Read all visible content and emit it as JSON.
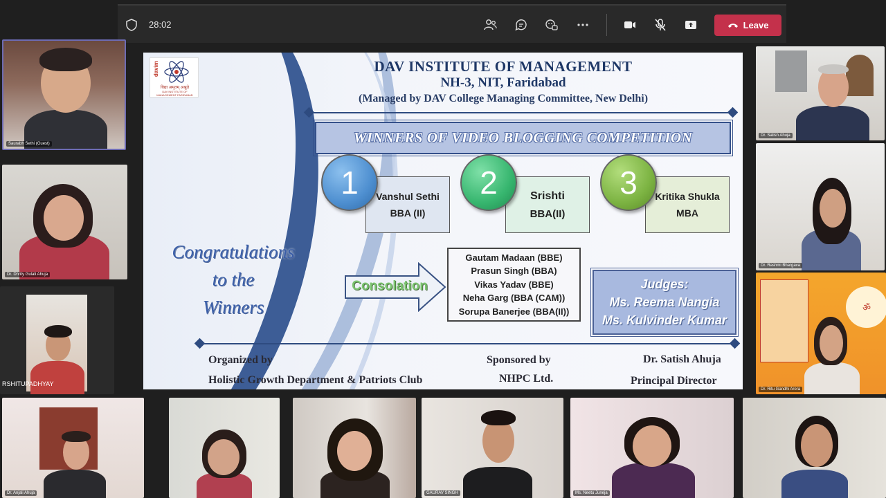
{
  "meeting": {
    "timer": "28:02",
    "leave_label": "Leave",
    "icons": [
      "shield-icon",
      "participants-icon",
      "chat-icon",
      "reactions-icon",
      "more-icon",
      "camera-icon",
      "mic-off-icon",
      "share-icon",
      "phone-icon"
    ]
  },
  "slide": {
    "logo": {
      "brand": "davim",
      "tagline": "विद्या अमृतम् अश्नुते",
      "subtitle": "DAV INSTITUTE OF MANAGEMENT FARIDABAD"
    },
    "institute": "DAV INSTITUTE OF MANAGEMENT",
    "address": "NH-3, NIT, Faridabad",
    "managed_by": "(Managed by DAV College Managing Committee, New Delhi)",
    "banner": "WINNERS OF VIDEO BLOGGING COMPETITION",
    "winners": [
      {
        "rank": "1",
        "name": "Vanshul Sethi",
        "course": "BBA (II)",
        "color": "#4e8fd0"
      },
      {
        "rank": "2",
        "name": "Srishti",
        "course": "BBA(II)",
        "color": "#37b66f"
      },
      {
        "rank": "3",
        "name": "Kritika Shukla",
        "course": "MBA",
        "color": "#7cb342"
      }
    ],
    "congrats": [
      "Congratulations",
      "to the",
      "Winners"
    ],
    "consolation_label": "Consolation",
    "consolation": [
      "Gautam Madaan (BBE)",
      "Prasun Singh (BBA)",
      "Vikas Yadav (BBE)",
      "Neha Garg (BBA (CAM))",
      "Sorupa Banerjee (BBA(II))"
    ],
    "judges_title": "Judges:",
    "judges": [
      "Ms. Reema Nangia",
      "Ms. Kulvinder Kumar"
    ],
    "organized_label": "Organized by",
    "organized_by": "Holistic Growth Department & Patriots Club",
    "sponsored_label": "Sponsored by",
    "sponsor": "NHPC Ltd.",
    "principal_name": "Dr. Satish Ahuja",
    "principal_title": "Principal Director"
  },
  "participants": {
    "left": [
      {
        "name": "Saurabh Sethi (Guest)"
      },
      {
        "name": "Dr. Dhrity Gulati Ahuja"
      },
      {
        "name": "RSHITUPADHYAY"
      }
    ],
    "right": [
      {
        "name": "Dr. Satish Ahuja"
      },
      {
        "name": "Dr. Rashmi Bhargava"
      },
      {
        "name": "Dr. Ritu Gandhi Arora"
      }
    ],
    "bottom": [
      {
        "name": "Dr. Anjali Ahuja"
      },
      {
        "name": ""
      },
      {
        "name": ""
      },
      {
        "name": "GAURAV SINGH"
      },
      {
        "name": "Ms. Neetu Juneja"
      },
      {
        "name": ""
      }
    ]
  }
}
